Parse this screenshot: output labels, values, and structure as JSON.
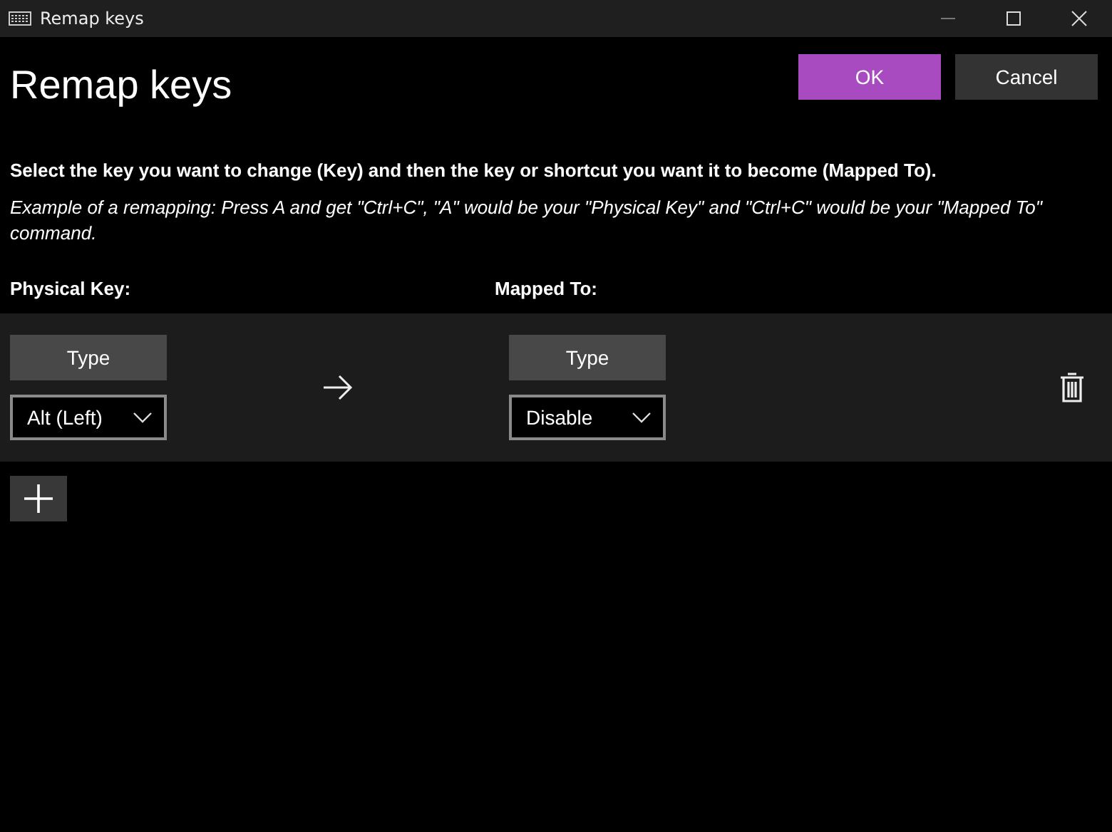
{
  "window": {
    "title": "Remap keys"
  },
  "heading": "Remap keys",
  "buttons": [
    {
      "label": "OK",
      "kind": "primary"
    },
    {
      "label": "Cancel",
      "kind": "secondary"
    }
  ],
  "instruction": "Select the key you want to change (Key) and then the key or shortcut you want it to become (Mapped To).",
  "example": "Example of a remapping: Press A and get \"Ctrl+C\", \"A\" would be your \"Physical Key\" and \"Ctrl+C\" would be your \"Mapped To\" command.",
  "columns": [
    "Physical Key:",
    "Mapped To:"
  ],
  "mappings": [
    {
      "physical": {
        "button": "Type",
        "value": "Alt (Left)"
      },
      "mapped": {
        "button": "Type",
        "value": "Disable"
      }
    }
  ]
}
